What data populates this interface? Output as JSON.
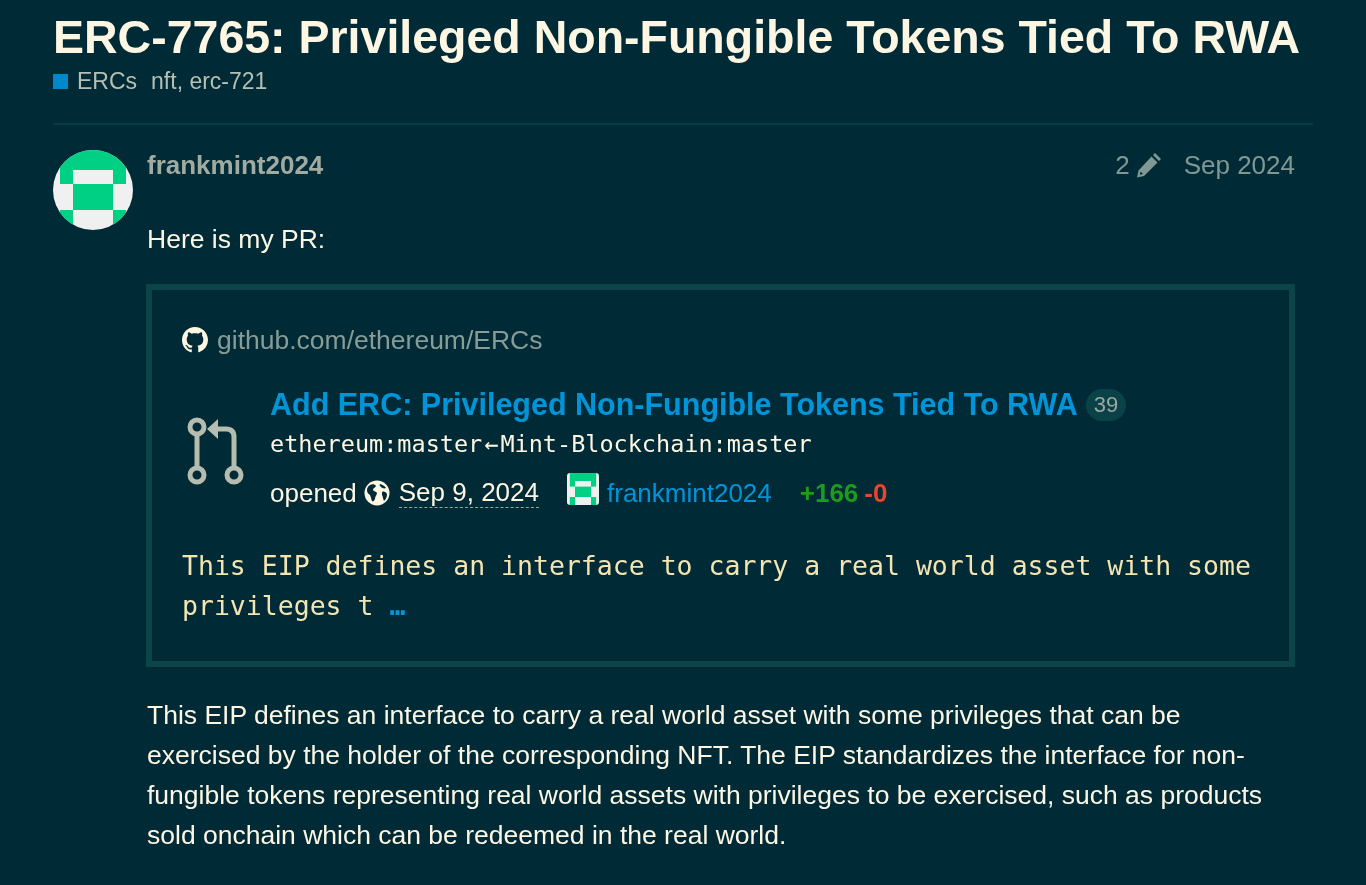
{
  "topic": {
    "title": "ERC-7765: Privileged Non-Fungible Tokens Tied To RWA",
    "category": "ERCs",
    "tags": "nft, erc-721"
  },
  "post": {
    "author": "frankmint2024",
    "edit_count": "2",
    "date": "Sep 2024",
    "intro": "Here is my PR:",
    "onebox": {
      "source": "github.com/ethereum/ERCs",
      "title": "Add ERC: Privileged Non-Fungible Tokens Tied To RWA",
      "comment_count": "39",
      "base_branch": "ethereum:master",
      "arrow": "←",
      "head_branch": "Mint-Blockchain:master",
      "opened_label": "opened",
      "opened_date": "Sep 9, 2024",
      "author": "frankmint2024",
      "additions": "+166",
      "deletions": "-0",
      "excerpt": "This EIP defines an interface to carry a real world asset with some privileges t",
      "more": "…"
    },
    "body": "This EIP defines an interface to carry a real world asset with some privileges that can be exercised by the holder of the corresponding NFT. The EIP standardizes the interface for non-fungible tokens representing real world assets with privileges to be exercised, such as products sold onchain which can be redeemed in the real world."
  }
}
